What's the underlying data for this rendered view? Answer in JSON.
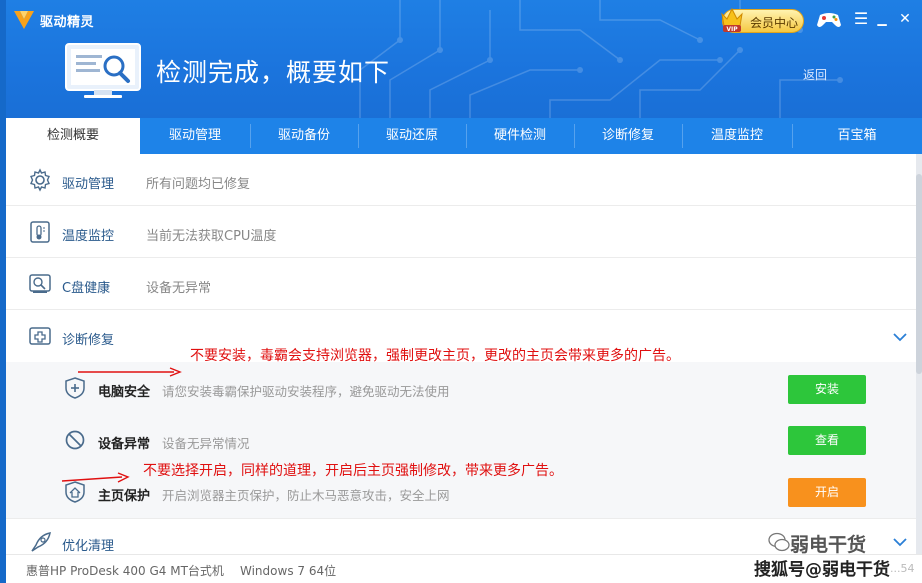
{
  "app": {
    "title": "驱动精灵"
  },
  "header": {
    "vip_label": "会员中心",
    "vip_badge": "VIP",
    "headline": "检测完成，概要如下",
    "back_label": "返回",
    "window_controls": {
      "menu": "☰",
      "minimize": "▁",
      "close": "✕"
    },
    "colors": {
      "bg": "#1b74dd",
      "tabs": "#1e83e8"
    }
  },
  "tabs": [
    {
      "label": "检测概要",
      "active": true
    },
    {
      "label": "驱动管理"
    },
    {
      "label": "驱动备份"
    },
    {
      "label": "驱动还原"
    },
    {
      "label": "硬件检测"
    },
    {
      "label": "诊断修复"
    },
    {
      "label": "温度监控"
    },
    {
      "label": "百宝箱"
    }
  ],
  "rows": [
    {
      "icon": "gear-icon",
      "title": "驱动管理",
      "desc": "所有问题均已修复"
    },
    {
      "icon": "thermometer-icon",
      "title": "温度监控",
      "desc": "当前无法获取CPU温度"
    },
    {
      "icon": "disk-icon",
      "title": "C盘健康",
      "desc": "设备无异常"
    },
    {
      "icon": "medical-cross-icon",
      "title": "诊断修复",
      "desc": ""
    },
    {
      "icon": "rocket-icon",
      "title": "优化清理",
      "desc": ""
    }
  ],
  "diag_items": [
    {
      "icon": "shield-plus-icon",
      "title": "电脑安全",
      "desc": "请您安装毒霸保护驱动安装程序，避免驱动无法使用",
      "button": "安装",
      "button_color": "#2dc63b"
    },
    {
      "icon": "ban-icon",
      "title": "设备异常",
      "desc": "设备无异常情况",
      "button": "查看",
      "button_color": "#2dc63b"
    },
    {
      "icon": "home-shield-icon",
      "title": "主页保护",
      "desc": "开启浏览器主页保护，防止木马恶意攻击，安全上网",
      "button": "开启",
      "button_color": "#f8911d"
    }
  ],
  "annotations": [
    "不要安装，毒霸会支持浏览器，强制更改主页，更改的主页会带来更多的广告。",
    "不要选择开启，同样的道理，开启后主页强制修改，带来更多广告。"
  ],
  "footer": {
    "model": "惠普HP ProDesk 400 G4 MT台式机",
    "os": "Windows 7 64位",
    "version": "...54"
  },
  "watermarks": {
    "account": "弱电干货",
    "platform": "搜狐号@弱电干货"
  }
}
